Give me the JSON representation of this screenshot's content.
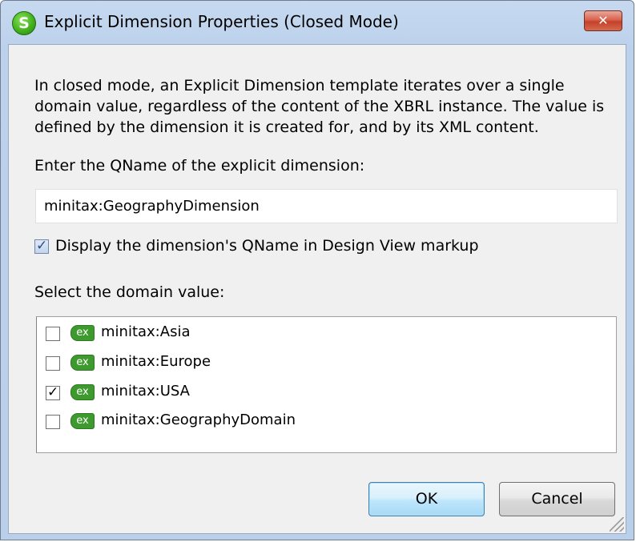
{
  "window": {
    "title": "Explicit Dimension Properties (Closed Mode)",
    "app_icon": "altova-stylevision-icon",
    "close_icon": "close-icon"
  },
  "description": "In closed mode, an Explicit Dimension template iterates over a single domain value, regardless of the content of the XBRL instance. The value is defined by the dimension it is created for, and by its XML content.",
  "qname": {
    "label": "Enter the QName of the explicit dimension:",
    "value": "minitax:GeographyDimension"
  },
  "display_option": {
    "label": "Display the dimension's QName in Design View markup",
    "checked": true
  },
  "domain": {
    "label": "Select the domain value:",
    "items": [
      {
        "icon_text": "ex",
        "label": "minitax:Asia",
        "checked": false
      },
      {
        "icon_text": "ex",
        "label": "minitax:Europe",
        "checked": false
      },
      {
        "icon_text": "ex",
        "label": "minitax:USA",
        "checked": true
      },
      {
        "icon_text": "ex",
        "label": "minitax:GeographyDomain",
        "checked": false
      }
    ]
  },
  "buttons": {
    "ok": "OK",
    "cancel": "Cancel"
  },
  "colors": {
    "title_bar": "#bcd1ec",
    "client_bg": "#f0f0f0",
    "close_button": "#c5412a",
    "ex_icon": "#3e9a2e",
    "ok_border": "#3c7fb1"
  }
}
